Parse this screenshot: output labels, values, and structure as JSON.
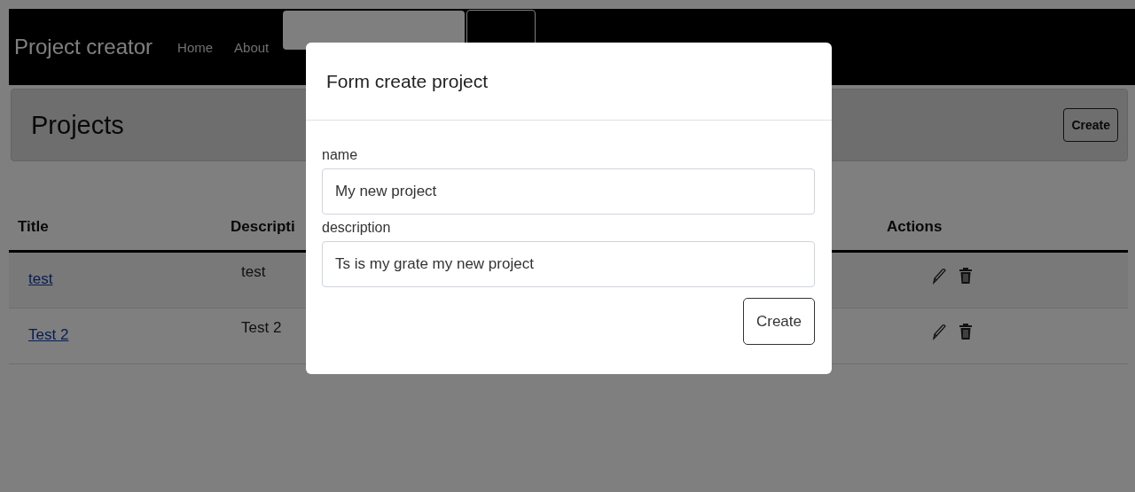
{
  "navbar": {
    "brand": "Project creator",
    "links": [
      "Home",
      "About"
    ]
  },
  "header": {
    "title": "Projects",
    "button": "Create"
  },
  "table": {
    "columns": [
      "Title",
      "Descripti",
      "Actions"
    ],
    "rows": [
      {
        "title": "test",
        "description": "test"
      },
      {
        "title": "Test 2",
        "description": "Test 2"
      }
    ]
  },
  "modal": {
    "title": "Form create project",
    "fields": [
      {
        "label": "name",
        "value": "My new project"
      },
      {
        "label": "description",
        "value": "Ts is my grate my new project"
      }
    ],
    "button": "Create"
  }
}
